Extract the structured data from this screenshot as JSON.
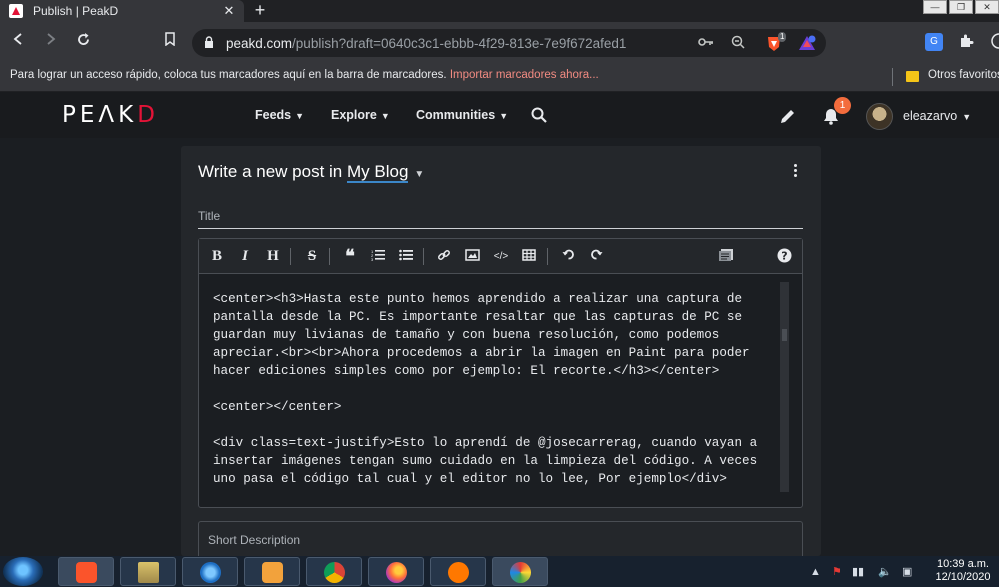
{
  "browser": {
    "tab": {
      "title": "Publish | PeakD",
      "close": "✕"
    },
    "new_tab": "+",
    "url": {
      "host": "peakd.com",
      "path": "/publish?draft=0640c3c1-ebbb-4f29-813e-7e9f672afed1"
    },
    "brave_badge": "1",
    "bookmarks": {
      "prompt": "Para lograr un acceso rápido, coloca tus marcadores aquí en la barra de marcadores.",
      "import_link": "Importar marcadores ahora...",
      "other": "Otros favoritos"
    }
  },
  "navbar": {
    "logo_main": "PE",
    "logo_a": "Λ",
    "logo_k": "K",
    "logo_d": "D",
    "items": [
      {
        "label": "Feeds"
      },
      {
        "label": "Explore"
      },
      {
        "label": "Communities"
      }
    ],
    "notification_count": "1",
    "username": "eleazarvo"
  },
  "editor": {
    "heading_prefix": "Write a new post in",
    "blog": "My Blog",
    "title_placeholder": "Title",
    "toolbar": [
      "B",
      "I",
      "H",
      "S",
      "❝",
      "1.",
      "•",
      "link",
      "image",
      "</>",
      "table",
      "undo",
      "redo",
      "preview",
      "?"
    ],
    "body": "<center><h3>Hasta este punto hemos aprendido a realizar una captura de pantalla desde la PC. Es importante resaltar que las capturas de PC se guardan muy livianas de tamaño y con buena resolución, como podemos apreciar.<br><br>Ahora procedemos a abrir la imagen en Paint para poder hacer ediciones simples como por ejemplo: El recorte.</h3></center>\n\n<center></center>\n\n<div class=text-justify>Esto lo aprendí de @josecarrerag, cuando vayan a insertar imágenes tengan sumo cuidado en la limpieza del código. A veces uno pasa el código tal cual y el editor no lo lee, Por ejemplo</div>",
    "short_description_placeholder": "Short Description"
  },
  "taskbar": {
    "apps": [
      "brave",
      "explorer",
      "internet-explorer",
      "media-player",
      "chrome",
      "firefox",
      "avast",
      "paint"
    ],
    "clock_time": "10:39 a.m.",
    "clock_date": "12/10/2020"
  },
  "colors": {
    "accent": "#3b87c9",
    "brand": "#e31337",
    "badge": "#f36c3d"
  }
}
